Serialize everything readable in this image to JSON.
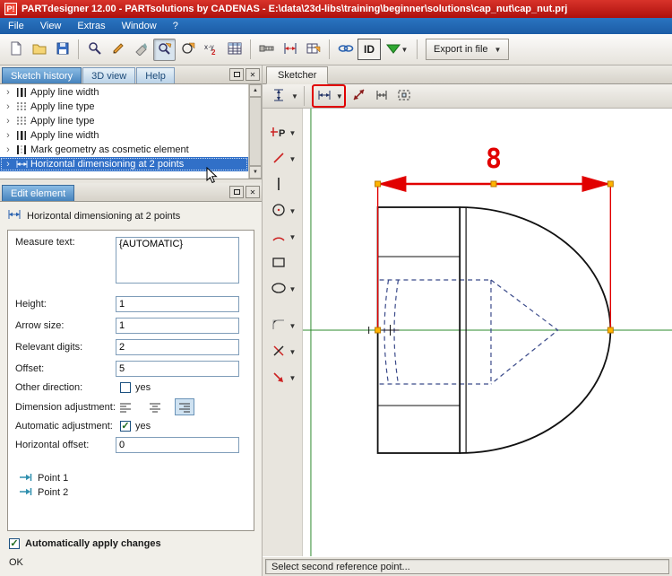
{
  "window": {
    "title": "PARTdesigner 12.00 - PARTsolutions by CADENAS - E:\\data\\23d-libs\\training\\beginner\\solutions\\cap_nut\\cap_nut.prj"
  },
  "menu": {
    "items": [
      {
        "label": "File"
      },
      {
        "label": "View"
      },
      {
        "label": "Extras"
      },
      {
        "label": "Window"
      },
      {
        "label": "?"
      }
    ]
  },
  "toolbar": {
    "id_button": "ID",
    "export_button": "Export in file"
  },
  "history_panel": {
    "tabs": [
      {
        "label": "Sketch history",
        "active": true
      },
      {
        "label": "3D view",
        "active": false
      },
      {
        "label": "Help",
        "active": false
      }
    ],
    "items": [
      {
        "label": "Apply line width",
        "selected": false
      },
      {
        "label": "Apply line type",
        "selected": false
      },
      {
        "label": "Apply line type",
        "selected": false
      },
      {
        "label": "Apply line width",
        "selected": false
      },
      {
        "label": "Mark geometry as cosmetic element",
        "selected": false
      },
      {
        "label": "Horizontal dimensioning at 2 points",
        "selected": true
      }
    ]
  },
  "edit_panel": {
    "tab_label": "Edit element",
    "header": "Horizontal dimensioning at 2 points",
    "labels": {
      "measure_text": "Measure text:",
      "height": "Height:",
      "arrow_size": "Arrow size:",
      "relevant_digits": "Relevant digits:",
      "offset": "Offset:",
      "other_direction": "Other direction:",
      "dimension_adjustment": "Dimension adjustment:",
      "automatic_adjustment": "Automatic adjustment:",
      "horizontal_offset": "Horizontal offset:",
      "point1": "Point 1",
      "point2": "Point 2",
      "yes": "yes"
    },
    "values": {
      "measure_text": "{AUTOMATIC}",
      "height": "1",
      "arrow_size": "1",
      "relevant_digits": "2",
      "offset": "5",
      "horizontal_offset": "0",
      "other_direction_checked": false,
      "automatic_adjustment_checked": true
    },
    "apply_checkbox_label": "Automatically apply changes",
    "apply_checked": true,
    "status": "OK"
  },
  "sketcher": {
    "tab_label": "Sketcher",
    "dimension_text": "8",
    "status": "Select second reference point..."
  },
  "colors": {
    "titlebar_red": "#c2160f",
    "menubar_blue": "#2066b0",
    "selection_blue": "#3170c8",
    "dimension_red": "#e10000",
    "axis_green": "#2e8b2e",
    "hidden_blue": "#3a4a8a",
    "point_orange": "#ffb400"
  }
}
